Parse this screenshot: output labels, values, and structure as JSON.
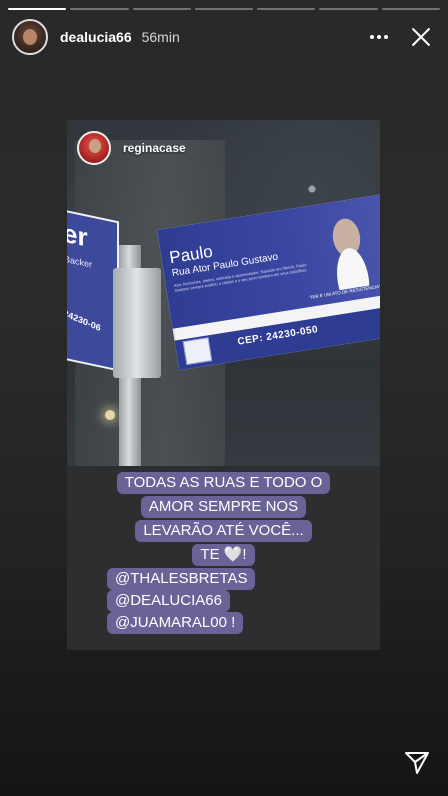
{
  "story": {
    "progress": [
      1,
      0,
      0,
      0,
      0,
      0,
      0
    ],
    "username": "dealucia66",
    "time": "56min"
  },
  "post": {
    "username": "reginacase",
    "sign": {
      "name": "Paulo",
      "street": "Rua Ator Paulo Gustavo",
      "description": "Ator, humorista, diretor, roteirista e apresentador. Nascido em Niterói, Paulo Gustavo sempre exaltou a cidade e o seu povo também em seus trabalhos.",
      "quote": "\"RIR É UM ATO DE RESISTÊNCIA\"",
      "cep": "CEP: 24230-050"
    },
    "left_sign": {
      "big": "er",
      "small": "Backer",
      "cep": "24230-06"
    }
  },
  "caption": {
    "lines": [
      "TODAS AS RUAS E TODO O",
      "AMOR  SEMPRE NOS",
      "LEVARÃO ATÉ VOCÊ...",
      "TE 🤍!"
    ],
    "mentions": [
      "@THALESBRETAS",
      "@DEALUCIA66",
      "@JUAMARAL00 !"
    ]
  }
}
